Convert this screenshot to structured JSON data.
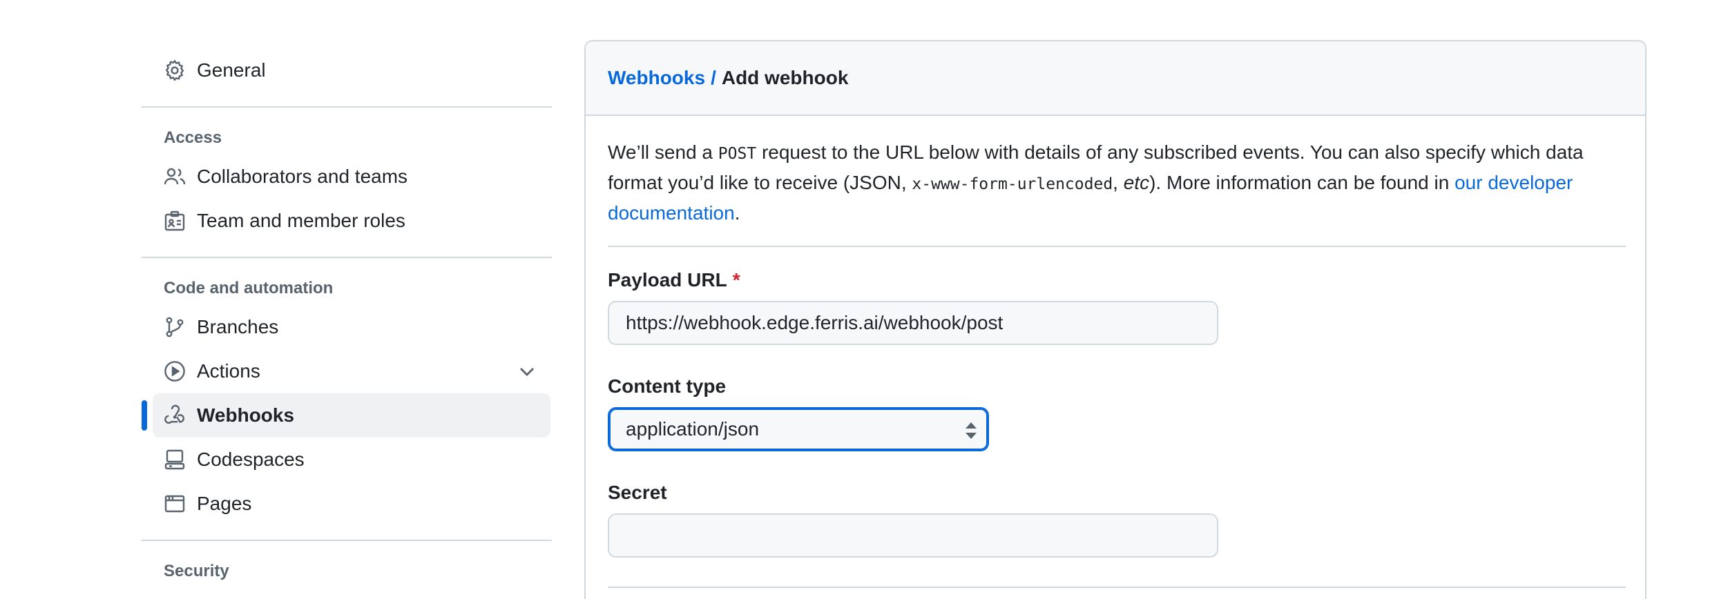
{
  "sidebar": {
    "general": "General",
    "access_heading": "Access",
    "access_items": [
      "Collaborators and teams",
      "Team and member roles"
    ],
    "code_heading": "Code and automation",
    "branches": "Branches",
    "actions": "Actions",
    "webhooks": "Webhooks",
    "codespaces": "Codespaces",
    "pages": "Pages",
    "security_heading": "Security"
  },
  "breadcrumb": {
    "parent": "Webhooks",
    "separator": "/",
    "current": "Add webhook"
  },
  "intro": {
    "part1": "We’ll send a ",
    "code1": "POST",
    "part2": " request to the URL below with details of any subscribed events. You can also specify which data format you’d like to receive (JSON, ",
    "code2": "x-www-form-urlencoded",
    "part3": ", ",
    "etc": "etc",
    "part4": "). More information can be found in ",
    "link": "our developer documentation",
    "part5": "."
  },
  "form": {
    "payload_label": "Payload URL",
    "required_mark": "*",
    "payload_value": "https://webhook.edge.ferris.ai/webhook/post",
    "content_type_label": "Content type",
    "content_type_value": "application/json",
    "secret_label": "Secret",
    "secret_value": ""
  },
  "colors": {
    "accent": "#0969da",
    "required": "#d1242f",
    "border": "#d1d9e0",
    "header_bg": "#f6f8fa"
  }
}
